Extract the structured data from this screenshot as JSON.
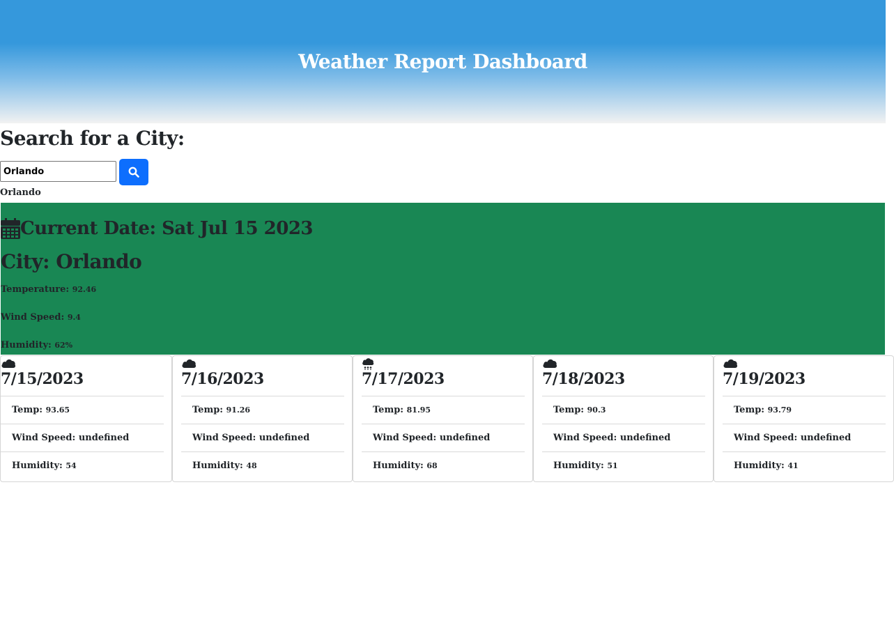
{
  "header": {
    "title": "Weather Report Dashboard"
  },
  "search": {
    "heading": "Search for a City:",
    "input_value": "Orlando",
    "button_icon": "search-icon",
    "history": [
      "Orlando"
    ]
  },
  "current": {
    "date_label": "Current Date: Sat Jul 15 2023",
    "city_label": "City: Orlando",
    "temperature_label": "Temperature:",
    "temperature_value": "92.46",
    "wind_label": "Wind Speed:",
    "wind_value": "9.4",
    "humidity_label": "Humidity:",
    "humidity_value": "62%",
    "icon": "calendar-icon",
    "bg_color": "#198754"
  },
  "forecast": [
    {
      "icon": "cloud-icon",
      "date": "7/15/2023",
      "temp_label": "Temp:",
      "temp": "93.65",
      "wind_label": "Wind Speed:",
      "wind": "undefined",
      "humidity_label": "Humidity:",
      "humidity": "54"
    },
    {
      "icon": "cloud-icon",
      "date": "7/16/2023",
      "temp_label": "Temp:",
      "temp": "91.26",
      "wind_label": "Wind Speed:",
      "wind": "undefined",
      "humidity_label": "Humidity:",
      "humidity": "48"
    },
    {
      "icon": "cloud-rain-icon",
      "date": "7/17/2023",
      "temp_label": "Temp:",
      "temp": "81.95",
      "wind_label": "Wind Speed:",
      "wind": "undefined",
      "humidity_label": "Humidity:",
      "humidity": "68"
    },
    {
      "icon": "cloud-icon",
      "date": "7/18/2023",
      "temp_label": "Temp:",
      "temp": "90.3",
      "wind_label": "Wind Speed:",
      "wind": "undefined",
      "humidity_label": "Humidity:",
      "humidity": "51"
    },
    {
      "icon": "cloud-icon",
      "date": "7/19/2023",
      "temp_label": "Temp:",
      "temp": "93.79",
      "wind_label": "Wind Speed:",
      "wind": "undefined",
      "humidity_label": "Humidity:",
      "humidity": "41"
    }
  ],
  "colors": {
    "accent": "#0d6efd",
    "header_blue": "#3598dc",
    "current_green": "#198754"
  }
}
